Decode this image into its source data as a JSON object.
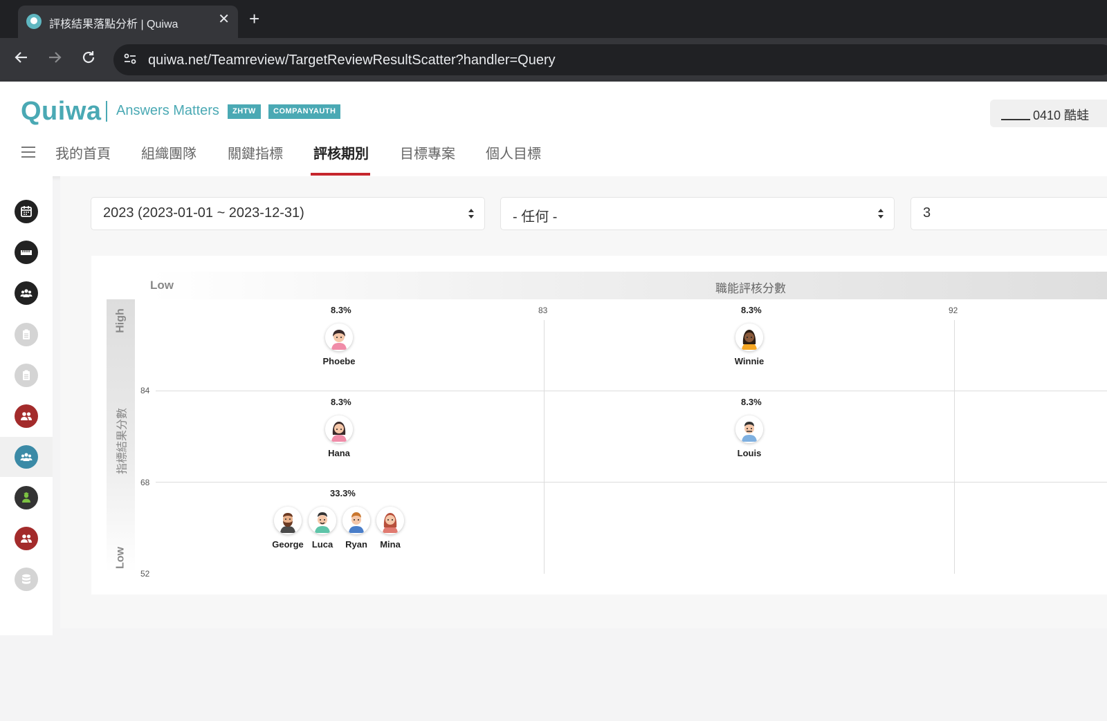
{
  "browser": {
    "tab_title": "評核結果落點分析 | Quiwa",
    "tab_close": "✕",
    "new_tab": "+",
    "url": "quiwa.net/Teamreview/TargetReviewResultScatter?handler=Query"
  },
  "header": {
    "logo": "Quiwa",
    "tagline": "Answers Matters",
    "badges": [
      "ZHTW",
      "COMPANYAUTH"
    ],
    "user": "0410 酷蛙"
  },
  "menu": {
    "items": [
      "我的首頁",
      "組織團隊",
      "關鍵指標",
      "評核期別",
      "目標專案",
      "個人目標"
    ],
    "active": "評核期別"
  },
  "sidebar": {
    "colors": [
      "#222222",
      "#222222",
      "#222222",
      "#cccccc",
      "#cccccc",
      "#a32b2b",
      "#3b8aa6",
      "#333333",
      "#a32b2b",
      "#cccccc"
    ],
    "icons": [
      "calendar-icon",
      "ruler-icon",
      "team-icon",
      "clipboard-icon",
      "clipboard-icon",
      "users-icon",
      "group-icon",
      "person-icon",
      "users-icon",
      "database-icon"
    ],
    "active_index": 6
  },
  "filters": {
    "period": "2023 (2023-01-01 ~ 2023-12-31)",
    "group": "- 任何 -",
    "count": "3"
  },
  "chart": {
    "x_low_label": "Low",
    "x_title": "職能評核分數",
    "y_high_label": "High",
    "y_title": "指標結果分數",
    "y_low_label": "Low",
    "x_ticks": [
      "83",
      "92"
    ],
    "y_ticks": [
      "84",
      "68",
      "52"
    ],
    "cells": [
      {
        "pct": "8.3%",
        "people": [
          "Phoebe"
        ]
      },
      {
        "pct": "8.3%",
        "people": [
          "Winnie"
        ]
      },
      {
        "pct": "8.3%",
        "people": [
          "Hana"
        ]
      },
      {
        "pct": "8.3%",
        "people": [
          "Louis"
        ]
      },
      {
        "pct": "33.3%",
        "people": [
          "George",
          "Luca",
          "Ryan",
          "Mina"
        ]
      }
    ]
  }
}
